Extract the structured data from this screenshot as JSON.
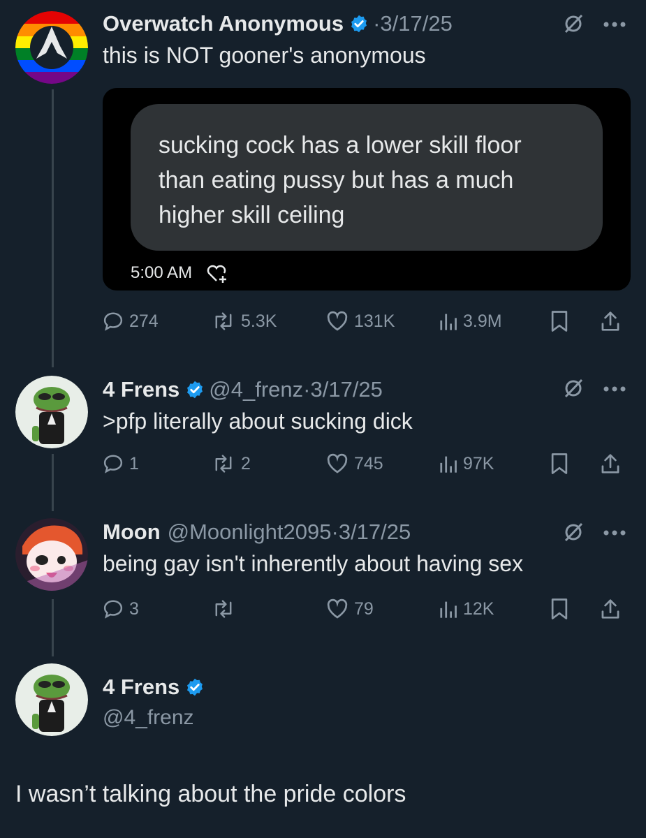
{
  "tweets": [
    {
      "name": "Overwatch Anonymous",
      "handle": "",
      "dot": "·",
      "date": "3/17/25",
      "text": "this is NOT gooner's anonymous",
      "embed": {
        "lines": [
          "sucking cock has a lower skill floor",
          "than eating pussy but has a much",
          "higher skill ceiling"
        ],
        "time": "5:00 AM"
      },
      "replies": "274",
      "retweets": "5.3K",
      "likes": "131K",
      "views": "3.9M"
    },
    {
      "name": "4 Frens",
      "handle": "@4_frenz",
      "dot": "·",
      "date": "3/17/25",
      "text": ">pfp literally about sucking dick",
      "replies": "1",
      "retweets": "2",
      "likes": "745",
      "views": "97K"
    },
    {
      "name": "Moon",
      "handle": "@Moonlight2095",
      "dot": "·",
      "date": "3/17/25",
      "text": "being gay isn't inherently about having sex",
      "replies": "3",
      "retweets": "",
      "likes": "79",
      "views": "12K"
    }
  ],
  "final_tweet": {
    "name": "4 Frens",
    "handle": "@4_frenz",
    "text": "I wasn’t talking about the pride colors"
  },
  "colors": {
    "background": "#15202b",
    "text": "#e7e9ea",
    "muted": "#8b98a5",
    "verified": "#1d9bf0"
  }
}
